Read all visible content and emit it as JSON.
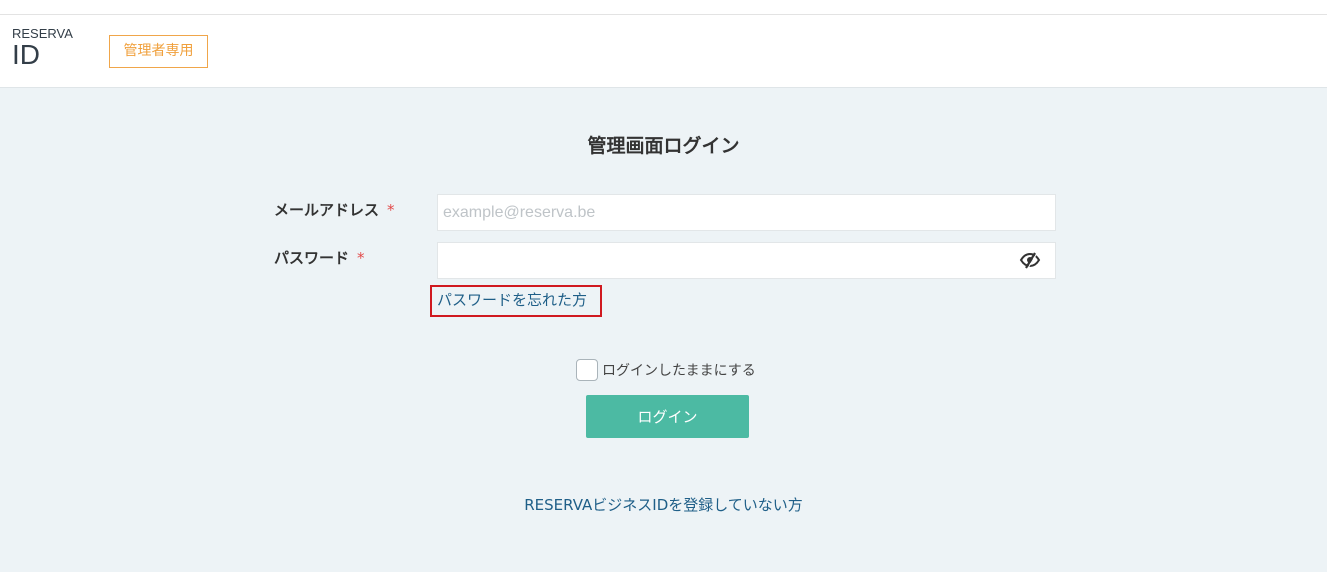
{
  "header": {
    "logo_line1": "RESERVA",
    "logo_line2": "ID",
    "admin_badge": "管理者専用"
  },
  "login": {
    "title": "管理画面ログイン",
    "email_label": "メールアドレス",
    "email_placeholder": "example@reserva.be",
    "email_value": "",
    "password_label": "パスワード",
    "password_value": "",
    "required_mark": "*",
    "forgot_password": "パスワードを忘れた方",
    "remember_me": "ログインしたままにする",
    "remember_checked": false,
    "login_button": "ログイン",
    "register_link": "RESERVAビジネスIDを登録していない方"
  },
  "icons": {
    "password_toggle": "eye-slash-icon"
  },
  "colors": {
    "accent": "#4cbaa3",
    "badge": "#f0a03c",
    "link": "#1f5f88",
    "required": "#e24a4a",
    "background": "#edf3f6",
    "highlight_border": "#d0191f"
  }
}
